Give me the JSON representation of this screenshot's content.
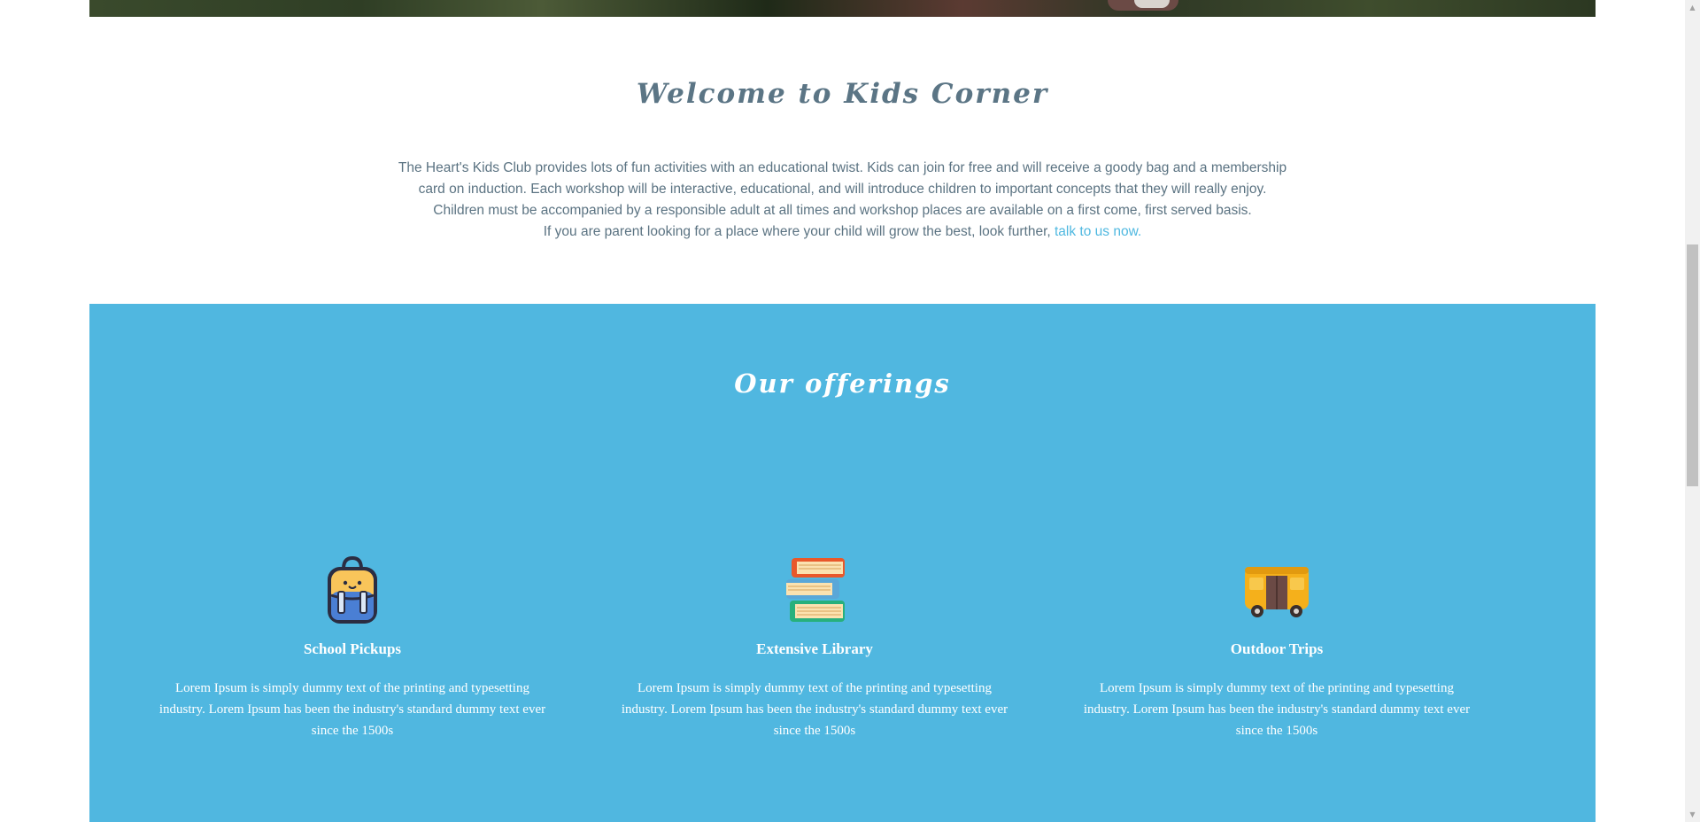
{
  "welcome": {
    "title": "Welcome to Kids Corner",
    "line1": "The Heart's Kids Club provides lots of fun activities with an educational twist. Kids can join for free and will receive a goody bag and a membership",
    "line2": "card on induction. Each workshop will be interactive, educational, and will introduce children to important concepts that they will really enjoy.",
    "line3": "Children must be accompanied by a responsible adult at all times and workshop places are available on a first come, first served basis.",
    "line4_prefix": "If you are parent looking for a place where your child will grow the best, look further, ",
    "line4_link": "talk to us now.",
    "link_color": "#4fb8e0"
  },
  "offerings": {
    "title": "Our offerings",
    "background_color": "#50b7e0",
    "items": [
      {
        "icon": "backpack-icon",
        "title": "School Pickups",
        "text": "Lorem Ipsum is simply dummy text of the printing and typesetting industry. Lorem Ipsum has been the industry's standard dummy text ever since the 1500s"
      },
      {
        "icon": "books-icon",
        "title": "Extensive Library",
        "text": "Lorem Ipsum is simply dummy text of the printing and typesetting industry. Lorem Ipsum has been the industry's standard dummy text ever since the 1500s"
      },
      {
        "icon": "bus-icon",
        "title": "Outdoor Trips",
        "text": "Lorem Ipsum is simply dummy text of the printing and typesetting industry. Lorem Ipsum has been the industry's standard dummy text ever since the 1500s"
      }
    ]
  }
}
